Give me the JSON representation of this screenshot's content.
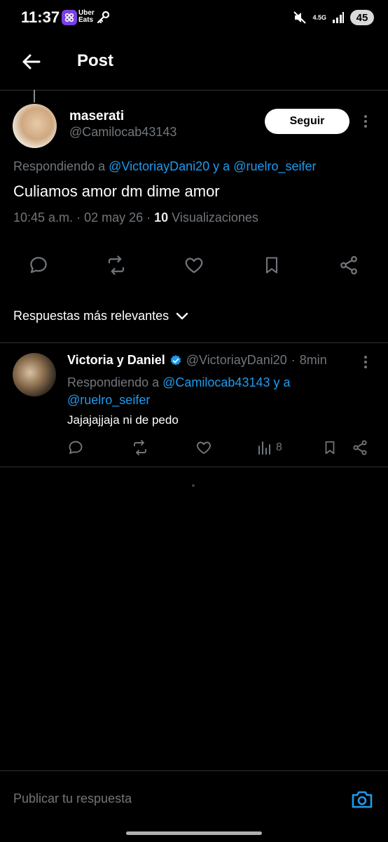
{
  "status_bar": {
    "time": "11:37",
    "uber_line1": "Uber",
    "uber_line2": "Eats",
    "network": "4.5G",
    "battery": "45"
  },
  "header": {
    "title": "Post"
  },
  "post": {
    "author_name": "maserati",
    "author_handle": "@Camilocab43143",
    "follow_label": "Seguir",
    "reply_prefix": "Respondiendo a",
    "reply_mention1": "@VictoriayDani20",
    "reply_joiner": "y a",
    "reply_mention2": "@ruelro_seifer",
    "text": "Culiamos amor dm dime amor",
    "time": "10:45 a.m.",
    "date": "02 may 26",
    "views_count": "10",
    "views_label": "Visualizaciones"
  },
  "sort": {
    "label": "Respuestas más relevantes"
  },
  "reply": {
    "author_name": "Victoria y Daniel",
    "author_handle": "@VictoriayDani20",
    "age": "8min",
    "reply_prefix": "Respondiendo a",
    "reply_mention1": "@Camilocab43143",
    "reply_joiner": "y a",
    "reply_mention2": "@ruelro_seifer",
    "text": "Jajajajjaja ni de pedo",
    "views": "8"
  },
  "composer": {
    "placeholder": "Publicar tu respuesta"
  },
  "colors": {
    "background": "#000000",
    "accent": "#1d9bf0",
    "muted": "#71767b",
    "uber_badge": "#7b3fe4"
  },
  "icons": {
    "back": "arrow-left-icon",
    "reply": "comment-icon",
    "retweet": "repost-icon",
    "like": "heart-icon",
    "bookmark": "bookmark-icon",
    "share": "share-icon",
    "views": "bar-chart-icon",
    "verified": "verified-badge-icon",
    "camera": "camera-icon"
  }
}
